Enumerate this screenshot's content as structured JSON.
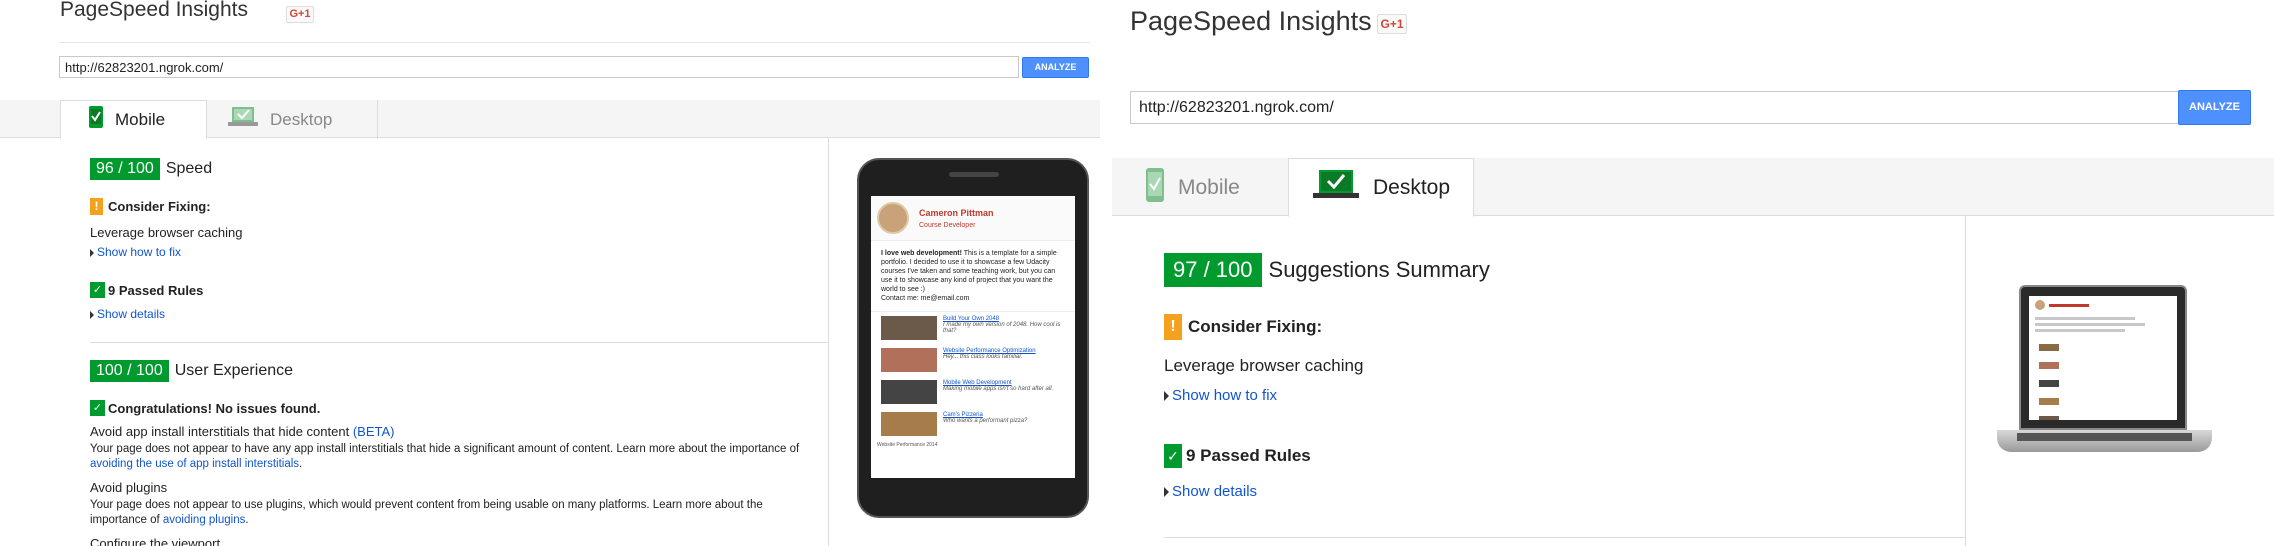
{
  "left": {
    "app_title": "PageSpeed Insights",
    "gplus_label": "G+1",
    "url_value": "http://62823201.ngrok.com/",
    "analyze_label": "ANALYZE",
    "tabs": [
      {
        "label": "Mobile",
        "active": true
      },
      {
        "label": "Desktop",
        "active": false
      }
    ],
    "speed": {
      "score": "96 / 100",
      "label": "Speed"
    },
    "consider_fixing": {
      "icon": "!",
      "label": "Consider Fixing:"
    },
    "rule": "Leverage browser caching",
    "show_how_to_fix": "Show how to fix",
    "passed_rules": {
      "icon": "✓",
      "label": "9 Passed Rules"
    },
    "show_details": "Show details",
    "ux": {
      "score": "100 / 100",
      "label": "User Experience"
    },
    "congrats": {
      "icon": "✓",
      "label": "Congratulations! No issues found."
    },
    "ux_items": [
      {
        "title": "Avoid app install interstitials that hide content",
        "badge": "(BETA)",
        "desc": "Your page does not appear to have any app install interstitials that hide a significant amount of content. Learn more about the importance of ",
        "link": "avoiding the use of app install interstitials",
        "tail": "."
      },
      {
        "title": "Avoid plugins",
        "badge": "",
        "desc": "Your page does not appear to use plugins, which would prevent content from being usable on many platforms. Learn more about the importance of ",
        "link": "avoiding plugins",
        "tail": "."
      },
      {
        "title": "Configure the viewport",
        "badge": "",
        "desc": "",
        "link": "",
        "tail": ""
      }
    ],
    "phone_preview": {
      "name": "Cameron Pittman",
      "role": "Course Developer",
      "intro_bold": "I love web development!",
      "intro": " This is a template for a simple portfolio. I decided to use it to showcase a few Udacity courses I've taken and some teaching work, but you can use it to showcase any kind of project that you want the world to see :)",
      "contact": "Contact me: me@email.com",
      "projects": [
        {
          "title": "Build Your Own 2048",
          "desc": "I made my own version of 2048. How cool is that?"
        },
        {
          "title": "Website Performance Optimization",
          "desc": "Hey... this class looks familiar."
        },
        {
          "title": "Mobile Web Development",
          "desc": "Making mobile apps isn't so hard after all."
        },
        {
          "title": "Cam's Pizzeria",
          "desc": "Who wants a performant pizza?"
        }
      ],
      "footer": "Website Performance 2014"
    }
  },
  "right": {
    "app_title": "PageSpeed Insights",
    "gplus_label": "G+1",
    "url_value": "http://62823201.ngrok.com/",
    "analyze_label": "ANALYZE",
    "tabs": [
      {
        "label": "Mobile",
        "active": false
      },
      {
        "label": "Desktop",
        "active": true
      }
    ],
    "summary": {
      "score": "97 / 100",
      "label": "Suggestions Summary"
    },
    "consider_fixing": {
      "icon": "!",
      "label": "Consider Fixing:"
    },
    "rule": "Leverage browser caching",
    "show_how_to_fix": "Show how to fix",
    "passed_rules": {
      "icon": "✓",
      "label": "9 Passed Rules"
    },
    "show_details": "Show details"
  },
  "colors": {
    "score_green": "#009a2e",
    "warn_orange": "#f4a11d",
    "link_blue": "#1155cc",
    "button_blue": "#4d90fe"
  }
}
